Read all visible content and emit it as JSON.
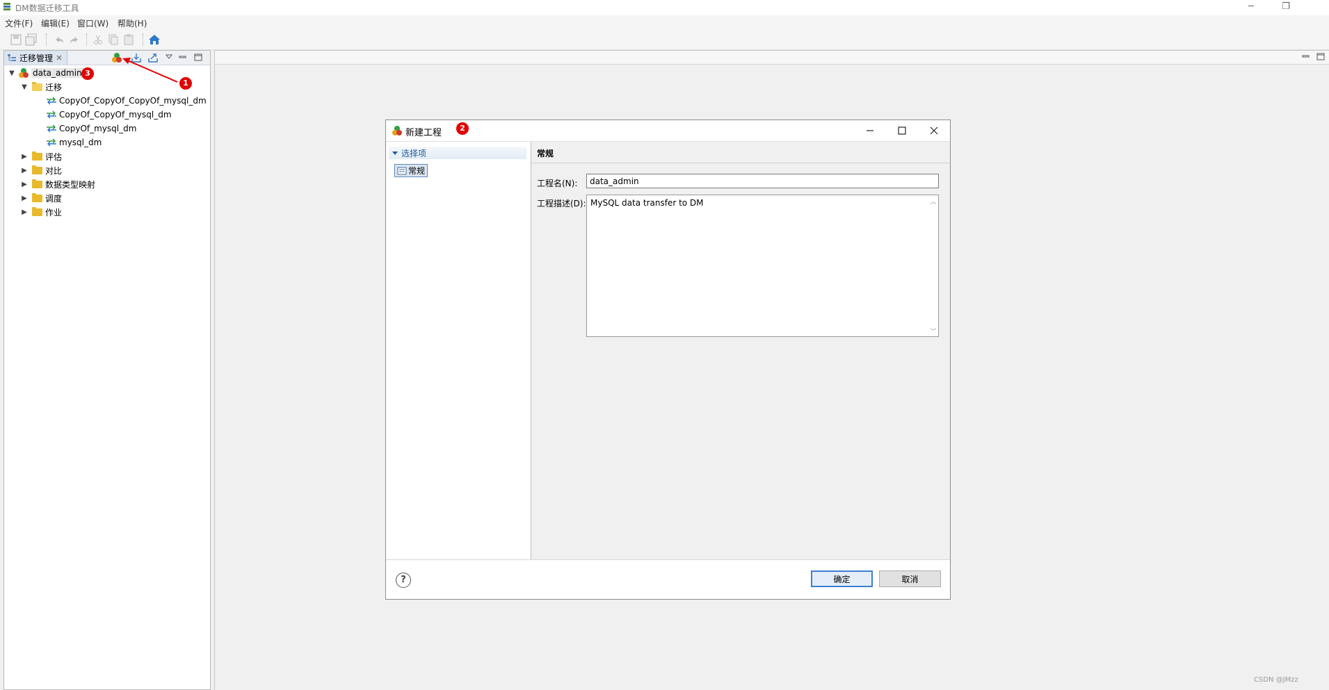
{
  "window": {
    "title": "DM数据迁移工具",
    "minimize_glyph": "─",
    "restore_glyph": "❐"
  },
  "menu": [
    "文件(F)",
    "编辑(E)",
    "窗口(W)",
    "帮助(H)"
  ],
  "left_panel": {
    "tab_label": "迁移管理",
    "tree": {
      "project": "data_admin",
      "migration_folder": "迁移",
      "migrations": [
        "CopyOf_CopyOf_CopyOf_mysql_dm",
        "CopyOf_CopyOf_mysql_dm",
        "CopyOf_mysql_dm",
        "mysql_dm"
      ],
      "folders": [
        "评估",
        "对比",
        "数据类型映射",
        "调度",
        "作业"
      ]
    }
  },
  "dialog": {
    "title": "新建工程",
    "options_header": "选择项",
    "options_item": "常规",
    "section_title": "常规",
    "name_label": "工程名(N):",
    "name_value": "data_admin",
    "desc_label": "工程描述(D):",
    "desc_value": "MySQL data transfer to DM",
    "ok_label": "确定",
    "cancel_label": "取消",
    "help_glyph": "?"
  },
  "annotations": {
    "badge1": "1",
    "badge2": "2",
    "badge3": "3",
    "badge_color": "#e00000"
  },
  "watermark": "CSDN @JMzz"
}
